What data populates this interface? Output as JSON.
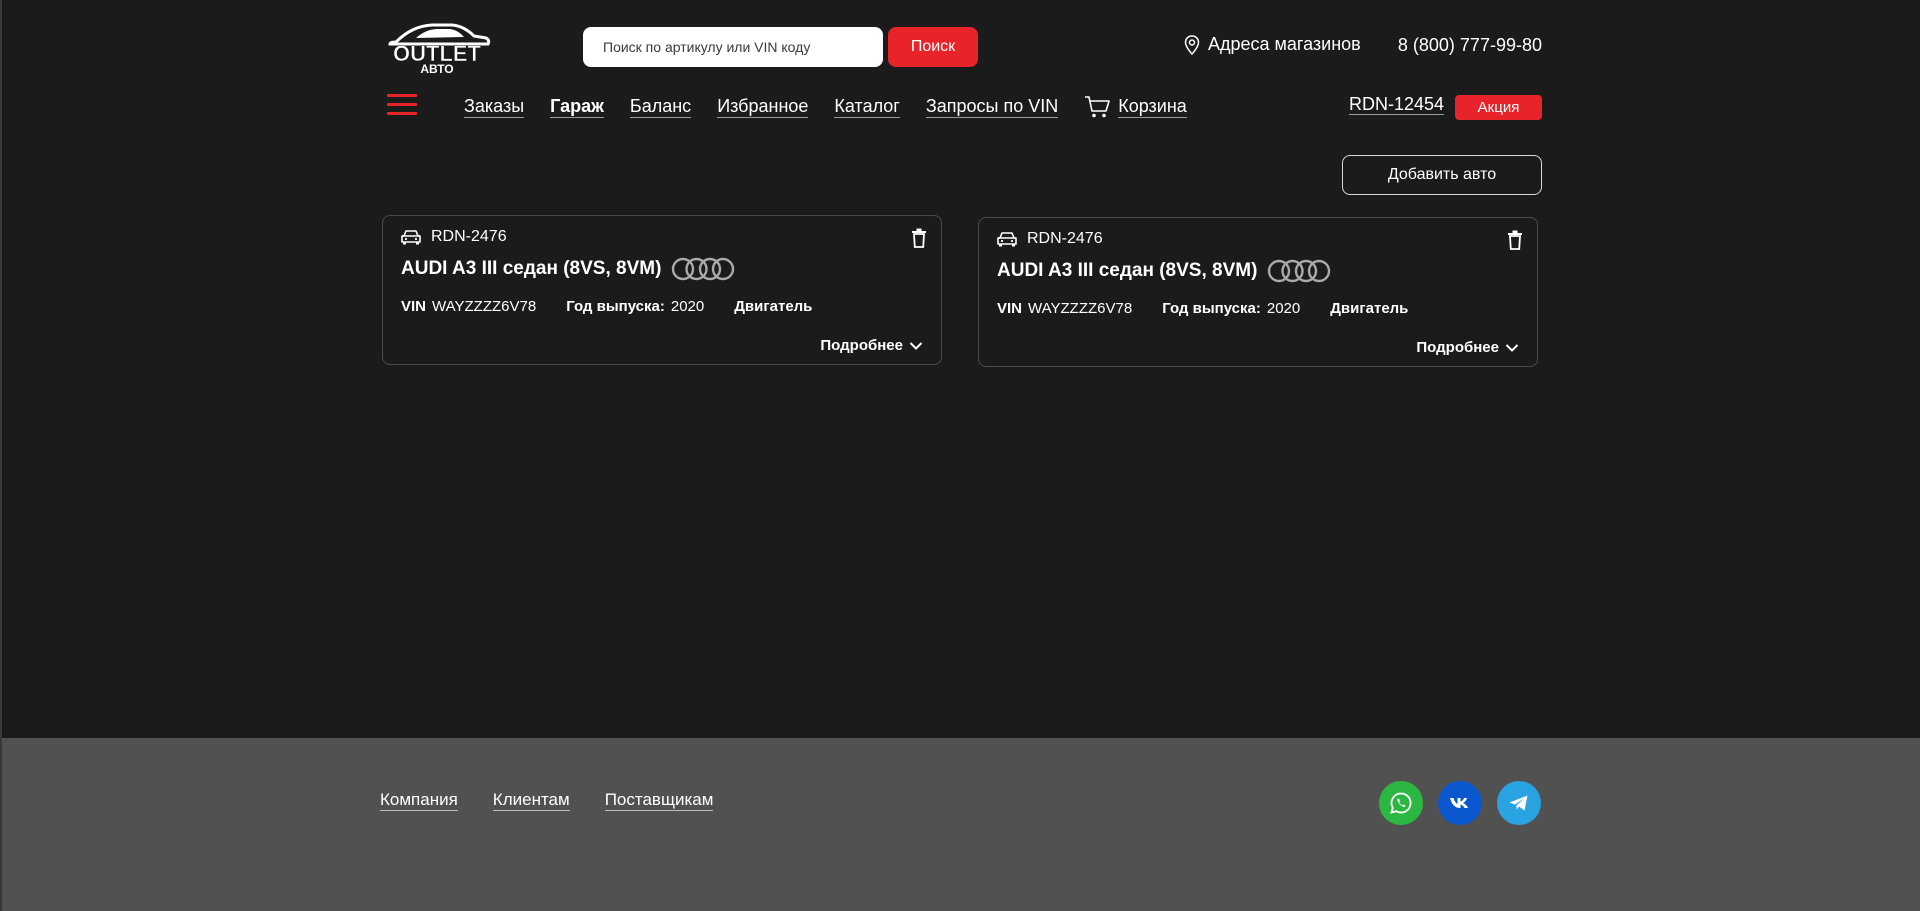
{
  "header": {
    "logo_text": "OUTLET",
    "logo_subtext": "АВТО",
    "search_placeholder": "Поиск по артикулу или VIN коду",
    "search_button": "Поиск",
    "stores_link": "Адреса магазинов",
    "phone": "8 (800) 777-99-80"
  },
  "nav": {
    "items": [
      {
        "label": "Заказы"
      },
      {
        "label": "Гараж",
        "active": true
      },
      {
        "label": "Баланс"
      },
      {
        "label": "Избранное"
      },
      {
        "label": "Каталог"
      },
      {
        "label": "Запросы по VIN"
      }
    ],
    "cart_label": "Корзина",
    "account_id": "RDN-12454",
    "promo_label": "Акция"
  },
  "garage": {
    "add_button": "Добавить авто",
    "cards": [
      {
        "id": "RDN-2476",
        "title": "AUDI A3 III седан (8VS, 8VM)",
        "vin_label": "VIN",
        "vin": "WAYZZZZ6V78",
        "year_label": "Год выпуска:",
        "year": "2020",
        "engine_label": "Двигатель",
        "more": "Подробнее"
      },
      {
        "id": "RDN-2476",
        "title": "AUDI A3 III седан (8VS, 8VM)",
        "vin_label": "VIN",
        "vin": "WAYZZZZ6V78",
        "year_label": "Год выпуска:",
        "year": "2020",
        "engine_label": "Двигатель",
        "more": "Подробнее"
      }
    ]
  },
  "footer": {
    "links": [
      "Компания",
      "Клиентам",
      "Поставщикам"
    ],
    "socials": [
      "whatsapp-icon",
      "vk-icon",
      "telegram-icon"
    ]
  },
  "colors": {
    "accent": "#e8232a",
    "background": "#1c1b1c",
    "footer": "#525152",
    "whatsapp": "#2cb742",
    "vk": "#0b57d0",
    "telegram": "#2aa3e3"
  }
}
